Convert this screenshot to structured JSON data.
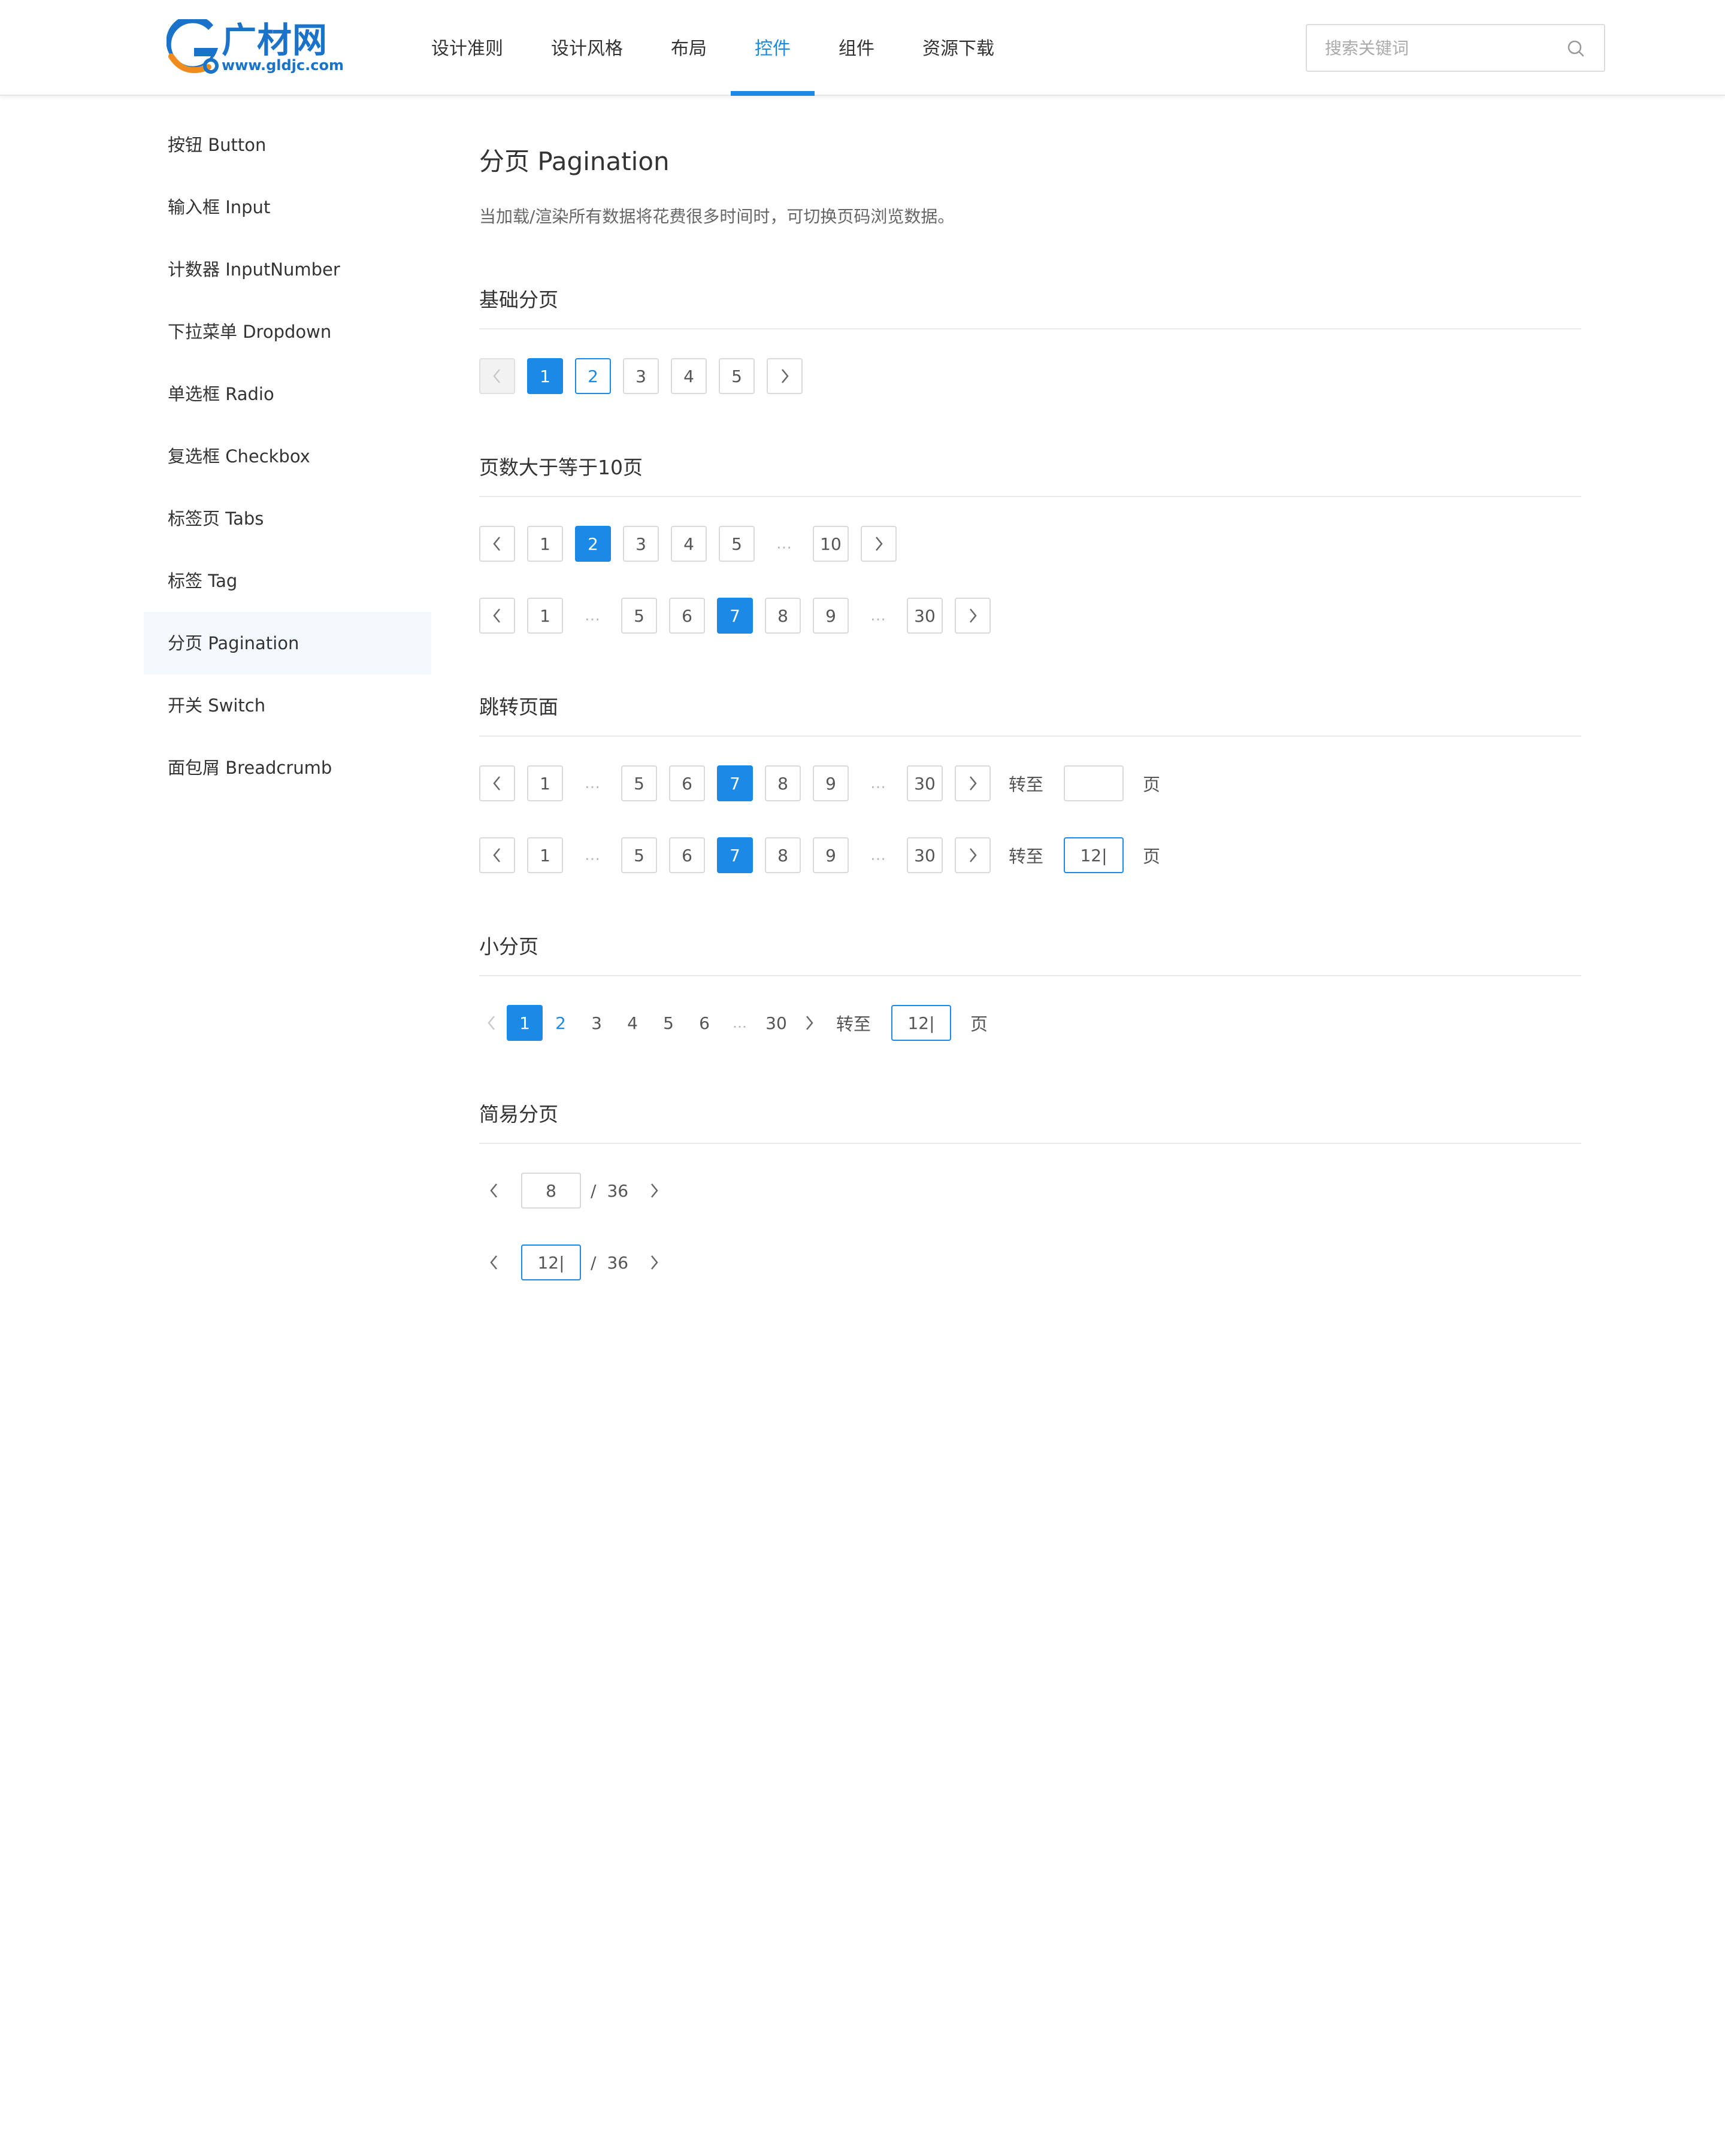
{
  "header": {
    "logo_text": "广材网",
    "logo_url": "www.gldjc.com",
    "nav": [
      {
        "label": "设计准则"
      },
      {
        "label": "设计风格"
      },
      {
        "label": "布局"
      },
      {
        "label": "控件"
      },
      {
        "label": "组件"
      },
      {
        "label": "资源下载"
      }
    ],
    "active_nav": "控件",
    "search_placeholder": "搜索关键词"
  },
  "sidebar": {
    "items": [
      {
        "label": "按钮 Button"
      },
      {
        "label": "输入框 Input"
      },
      {
        "label": "计数器 InputNumber"
      },
      {
        "label": "下拉菜单 Dropdown"
      },
      {
        "label": "单选框 Radio"
      },
      {
        "label": "复选框 Checkbox"
      },
      {
        "label": "标签页 Tabs"
      },
      {
        "label": "标签 Tag"
      },
      {
        "label": "分页 Pagination"
      },
      {
        "label": "开关 Switch"
      },
      {
        "label": "面包屑 Breadcrumb"
      }
    ],
    "active_item": "分页 Pagination"
  },
  "main": {
    "title": "分页 Pagination",
    "description": "当加载/渲染所有数据将花费很多时间时，可切换页码浏览数据。",
    "sections": {
      "basic": {
        "title": "基础分页",
        "pages": [
          "1",
          "2",
          "3",
          "4",
          "5"
        ],
        "current": "1",
        "hover": "2"
      },
      "many": {
        "title": "页数大于等于10页",
        "row1": {
          "pages": [
            "1",
            "2",
            "3",
            "4",
            "5",
            "…",
            "10"
          ],
          "current": "2"
        },
        "row2": {
          "pages": [
            "1",
            "…",
            "5",
            "6",
            "7",
            "8",
            "9",
            "…",
            "30"
          ],
          "current": "7"
        }
      },
      "jump": {
        "title": "跳转页面",
        "pages": [
          "1",
          "…",
          "5",
          "6",
          "7",
          "8",
          "9",
          "…",
          "30"
        ],
        "current": "7",
        "jump_label": "转至",
        "jump_suffix": "页",
        "row1_value": "",
        "row2_value": "12|"
      },
      "small": {
        "title": "小分页",
        "pages": [
          "1",
          "2",
          "3",
          "4",
          "5",
          "6",
          "…",
          "30"
        ],
        "current": "1",
        "hover": "2",
        "jump_label": "转至",
        "jump_suffix": "页",
        "jump_value": "12|"
      },
      "simple": {
        "title": "简易分页",
        "separator": "/",
        "total": "36",
        "row1_value": "8",
        "row2_value": "12|"
      }
    }
  },
  "colors": {
    "accent": "#1a8ae6",
    "border": "#d9d9d9",
    "text": "#333333",
    "muted": "#666666",
    "active_bg": "#f4f9fd"
  }
}
